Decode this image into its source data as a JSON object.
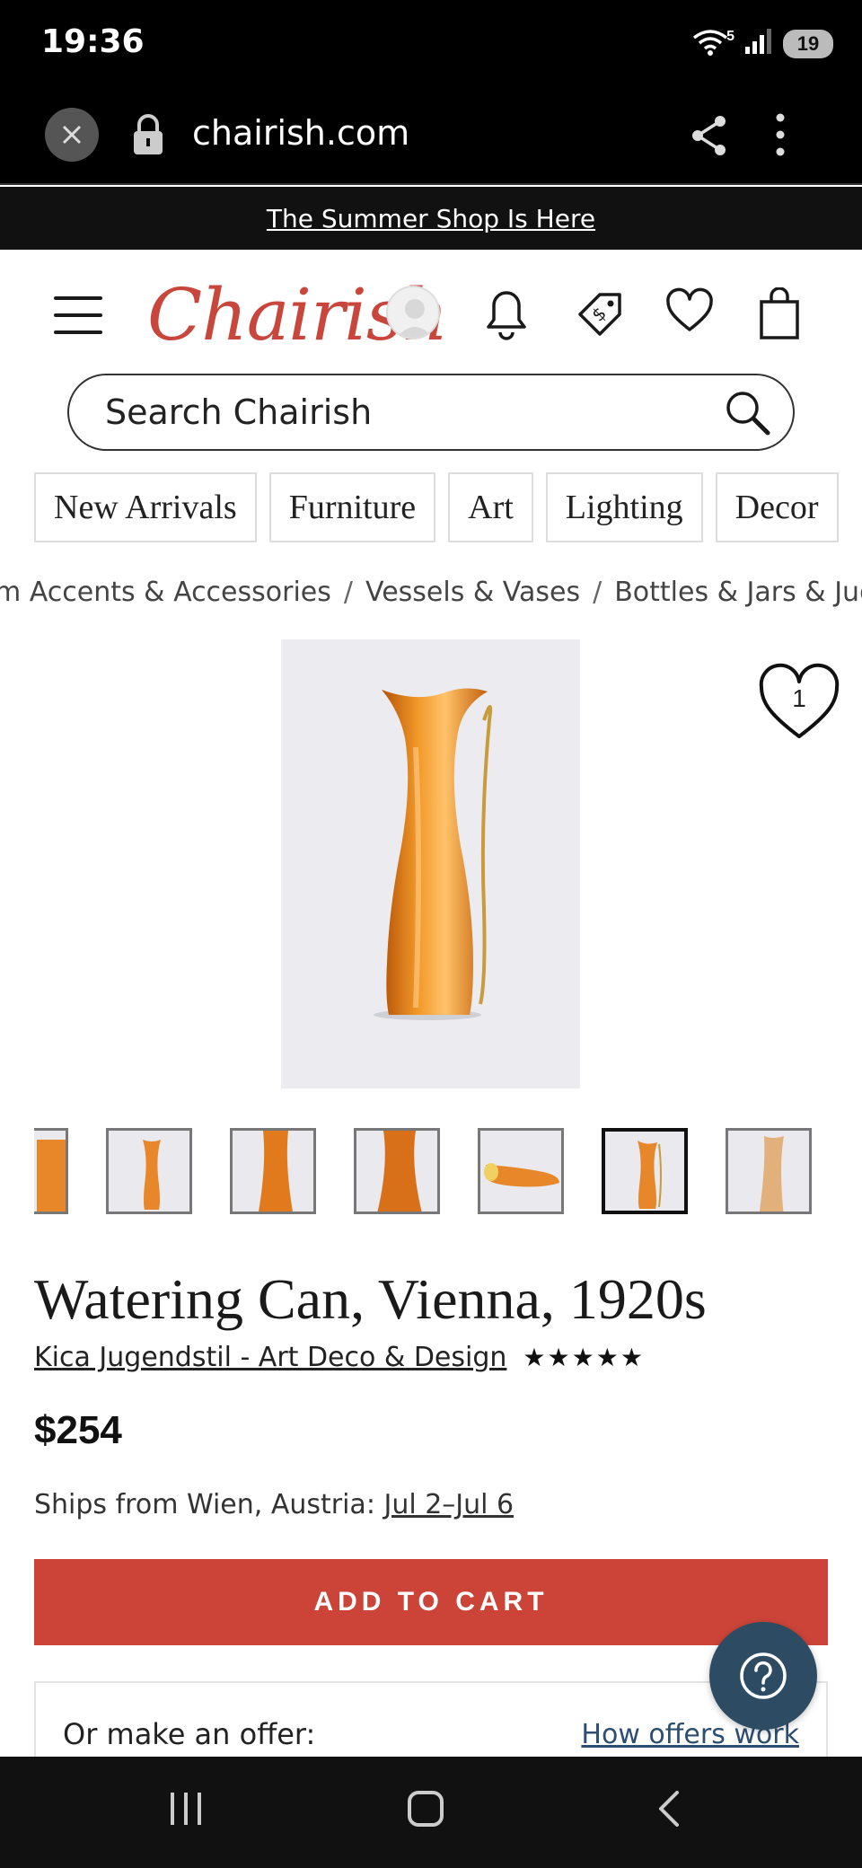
{
  "status": {
    "time": "19:36",
    "battery": "19",
    "wifi_badge": "5"
  },
  "browser": {
    "url": "chairish.com"
  },
  "promo": {
    "text": "The Summer Shop Is Here"
  },
  "header": {
    "logo": "Chairish"
  },
  "search": {
    "placeholder": "Search Chairish"
  },
  "categories": [
    "New Arrivals",
    "Furniture",
    "Art",
    "Lighting",
    "Decor"
  ],
  "breadcrumb": [
    "m Accents & Accessories",
    "Vessels & Vases",
    "Bottles & Jars & Jugs"
  ],
  "breadcrumb_separator": "/",
  "product": {
    "favorite_count": "1",
    "title": "Watering Can, Vienna, 1920s",
    "seller": "Kica Jugendstil - Art Deco & Design",
    "rating_stars": "★★★★★",
    "price": "$254",
    "ships_prefix": "Ships from Wien, Austria: ",
    "ships_dates": "Jul 2–Jul 6",
    "active_thumbnail_index": 5
  },
  "actions": {
    "add_to_cart": "ADD TO CART",
    "offer_label": "Or make an offer:",
    "offer_link": "How offers work"
  },
  "colors": {
    "accent": "#cc4438",
    "logo": "#c9463d",
    "help_button": "#2d4c64"
  }
}
